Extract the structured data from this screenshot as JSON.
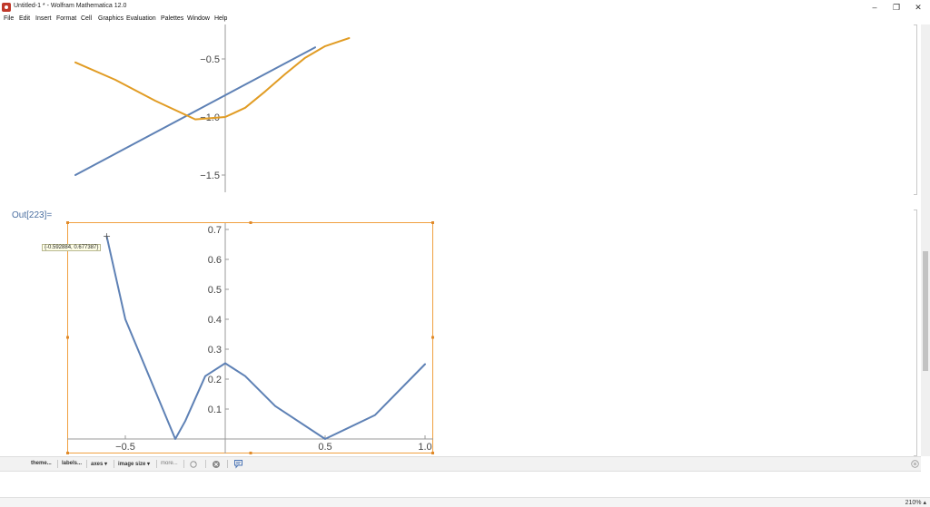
{
  "window": {
    "title": "Untitled-1 * - Wolfram Mathematica 12.0",
    "minimize": "–",
    "restore": "❐",
    "close": "✕"
  },
  "menu": [
    "File",
    "Edit",
    "Insert",
    "Format",
    "Cell",
    "Graphics",
    "Evaluation",
    "Palettes",
    "Window",
    "Help"
  ],
  "cells": {
    "out_label": "Out[223]=",
    "tooltip": "{-0.592884, 0.677387}"
  },
  "chart_data": [
    {
      "type": "line",
      "title": "",
      "xlabel": "",
      "ylabel": "",
      "y_ticks": [
        "-0.5",
        "-1.0",
        "-1.5"
      ],
      "x_range_visible": [
        -0.75,
        0.62
      ],
      "series": [
        {
          "color": "#5E81B5",
          "x": [
            -0.75,
            0.45
          ],
          "y": [
            -1.5,
            -0.4
          ]
        },
        {
          "color": "#E19C24",
          "x": [
            -0.75,
            -0.55,
            -0.35,
            -0.15,
            0.0,
            0.1,
            0.2,
            0.3,
            0.4,
            0.5,
            0.62
          ],
          "y": [
            -0.53,
            -0.68,
            -0.86,
            -1.02,
            -1.0,
            -0.92,
            -0.78,
            -0.63,
            -0.49,
            -0.39,
            -0.32
          ]
        }
      ]
    },
    {
      "type": "line",
      "title": "",
      "xlabel": "",
      "ylabel": "",
      "x_ticks": [
        "-0.5",
        "0.5",
        "1.0"
      ],
      "y_ticks": [
        "0.1",
        "0.2",
        "0.3",
        "0.4",
        "0.5",
        "0.6",
        "0.7"
      ],
      "xlim": [
        -0.8,
        1.05
      ],
      "ylim": [
        0,
        0.71
      ],
      "series": [
        {
          "color": "#5E81B5",
          "x": [
            -0.593,
            -0.5,
            -0.25,
            -0.2,
            -0.1,
            0.0,
            0.1,
            0.25,
            0.5,
            0.75,
            1.0
          ],
          "y": [
            0.677,
            0.4,
            0.0,
            0.06,
            0.21,
            0.253,
            0.21,
            0.11,
            0.0,
            0.08,
            0.25
          ]
        }
      ]
    }
  ],
  "toolbar": {
    "theme": "theme...",
    "labels": "labels...",
    "axes": "axes ▾",
    "image_size": "image size ▾",
    "more": "more..."
  },
  "status": {
    "zoom": "210% ▴"
  }
}
